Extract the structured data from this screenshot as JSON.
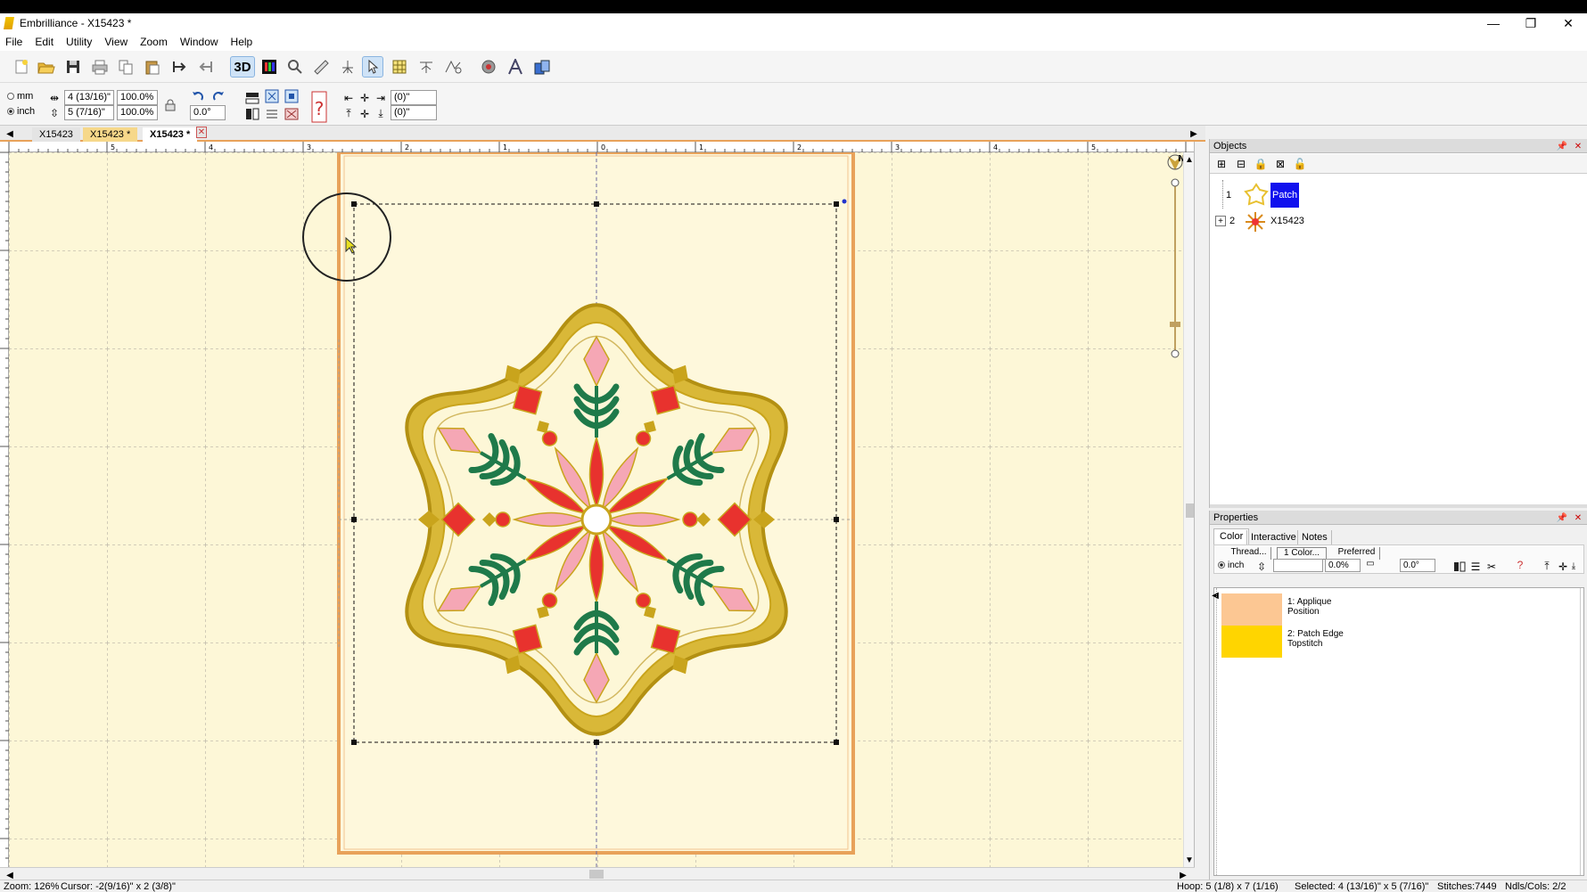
{
  "window": {
    "title": "Embrilliance - X15423 *",
    "minimize": "—",
    "restore": "❐",
    "close": "✕"
  },
  "menu": [
    "File",
    "Edit",
    "Utility",
    "View",
    "Zoom",
    "Window",
    "Help"
  ],
  "toolbar": {
    "tool_3d": "3D",
    "icons": [
      "new-icon",
      "open-icon",
      "save-icon",
      "print-icon",
      "copy-icon",
      "paste-icon",
      "merge-icon",
      "split-icon",
      "3d-view-icon",
      "color-palette-icon",
      "zoom-icon",
      "measure-icon",
      "stitch-icon",
      "select-icon",
      "grid-icon",
      "text-path-icon",
      "tools-icon",
      "settings-icon",
      "lettering-icon",
      "export-icon"
    ]
  },
  "size_controls": {
    "unit_mm": "mm",
    "unit_inch": "inch",
    "unit_selected": "inch",
    "width": "4 (13/16)\"",
    "height": "5 (7/16)\"",
    "width_pct": "100.0%",
    "height_pct": "100.0%",
    "rotation": "0.0°",
    "pos_x": "(0)\"",
    "pos_y": "(0)\""
  },
  "tabs": [
    "X15423",
    "X15423 *",
    "X15423 *"
  ],
  "tabs_active_index": 2,
  "ruler": {
    "top_labels": [
      "5",
      "4",
      "3",
      "2",
      "1",
      "0",
      "1",
      "2",
      "3",
      "4",
      "5"
    ]
  },
  "objects_panel": {
    "title": "Objects",
    "items": [
      {
        "num": "1",
        "label": "Patch",
        "selected": true
      },
      {
        "num": "2",
        "label": "X15423",
        "selected": false
      }
    ]
  },
  "properties_panel": {
    "title": "Properties",
    "tabs": [
      "Color",
      "Interactive",
      "Notes"
    ],
    "buttons": {
      "thread": "Thread...",
      "one_color": "1 Color...",
      "preferred": "Preferred"
    },
    "unit": "inch",
    "pct": "0.0%",
    "angle": "0.0°",
    "colors": [
      {
        "line1": "1: Applique",
        "line2": "Position",
        "swatch": "#fcc793"
      },
      {
        "line1": "2: Patch Edge",
        "line2": "Topstitch",
        "swatch": "#ffd500"
      }
    ]
  },
  "status": {
    "zoom": "Zoom: 126%",
    "cursor": "Cursor: -2(9/16)\" x 2 (3/8)\"",
    "hoop": "Hoop: 5 (1/8) x 7 (1/16)",
    "selected": "Selected: 4 (13/16)\" x 5 (7/16)\"",
    "stitches": "Stitches:7449",
    "ndls": "Ndls/Cols: 2/2"
  },
  "colors": {
    "canvas_bg": "#fdf7d7",
    "hoop_edge": "#e8a25a",
    "gold": "#c9a41c",
    "red": "#e8322e",
    "pink": "#f5a7b5",
    "green": "#1f7a4a",
    "selection_blue": "#0000ff"
  }
}
